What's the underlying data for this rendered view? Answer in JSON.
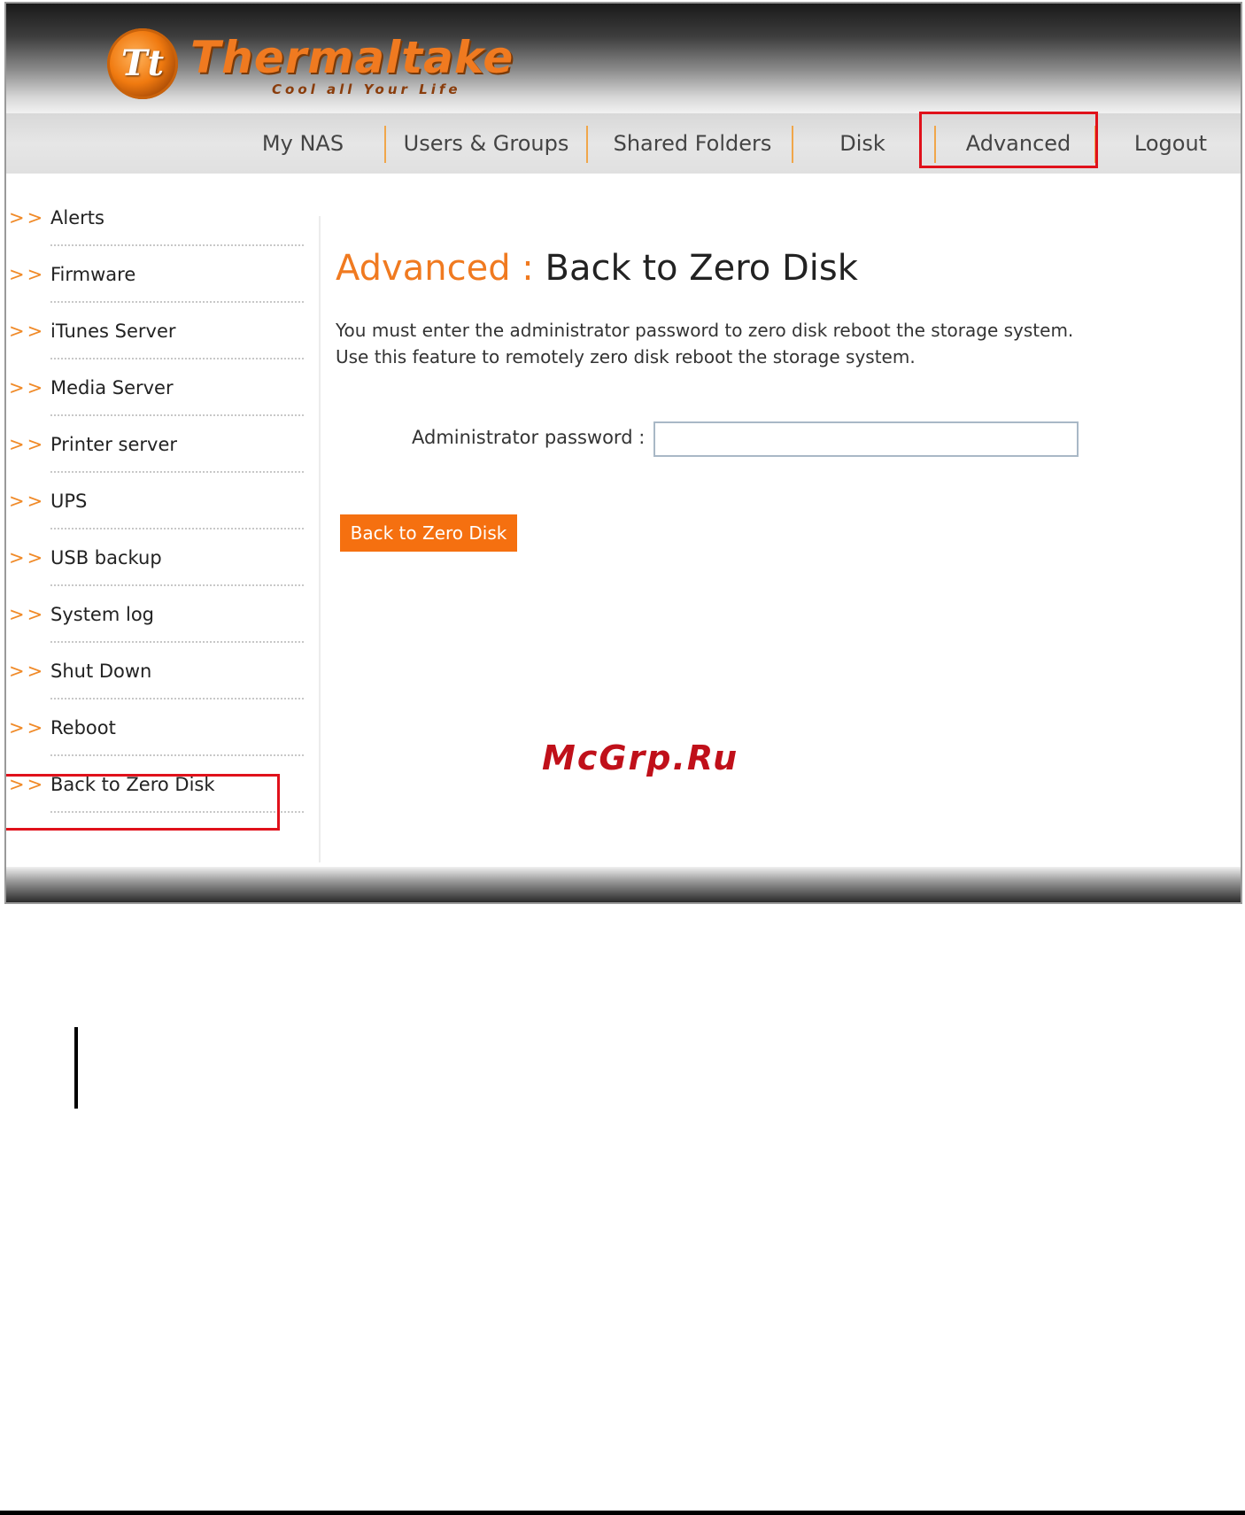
{
  "brand": {
    "logo_mark": "Tt",
    "name": "Thermaltake",
    "tagline": "Cool all Your Life"
  },
  "nav": {
    "items": [
      "My NAS",
      "Users & Groups",
      "Shared Folders",
      "Disk",
      "Advanced",
      "Logout"
    ],
    "selected": "Advanced"
  },
  "sidebar": {
    "arrow": ">>",
    "items": [
      "Alerts",
      "Firmware",
      "iTunes Server",
      "Media Server",
      "Printer server",
      "UPS",
      "USB backup",
      "System log",
      "Shut Down",
      "Reboot",
      "Back to Zero Disk"
    ],
    "selected": "Back to Zero Disk"
  },
  "main": {
    "heading_section": "Advanced :",
    "heading_page": "Back to Zero Disk",
    "description_line1": "You must enter the administrator password to zero disk reboot the storage system.",
    "description_line2": "Use this feature to remotely zero disk reboot the storage system.",
    "password_label": "Administrator password  :",
    "password_value": "",
    "action_button": "Back to Zero Disk"
  },
  "watermark": "McGrp.Ru",
  "colors": {
    "accent": "#f07a20",
    "button": "#f57010",
    "highlight": "#e0111b"
  }
}
